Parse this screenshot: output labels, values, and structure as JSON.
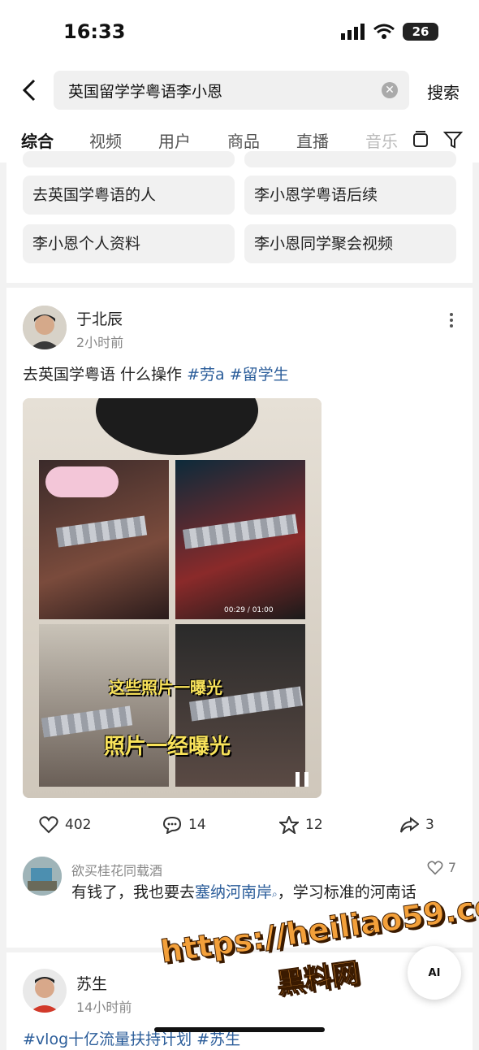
{
  "status": {
    "time": "16:33",
    "battery": "26"
  },
  "search": {
    "query": "英国留学学粤语李小恩",
    "button": "搜索"
  },
  "tabs": [
    "综合",
    "视频",
    "用户",
    "商品",
    "直播",
    "音乐"
  ],
  "suggestions": [
    "去英国学粤语的人",
    "李小恩学粤语后续",
    "李小恩个人资料",
    "李小恩同学聚会视频"
  ],
  "post": {
    "author": "于北辰",
    "time": "2小时前",
    "text": "去英国学粤语 什么操作 ",
    "tags": [
      "#劳a",
      "#留学生"
    ],
    "overlay_top": "这些照片一曝光",
    "overlay_bottom": "照片一经曝光",
    "video_time": "00:29 / 01:00",
    "likes": "402",
    "comments": "14",
    "favorites": "12",
    "shares": "3"
  },
  "comment": {
    "author": "欲买桂花同载酒",
    "likes": "7",
    "text_before": "有钱了，我也要去",
    "link": "塞纳河南岸",
    "text_after": "，学习标准的河南话"
  },
  "post2": {
    "author": "苏生",
    "time": "14小时前",
    "text": "#vlog十亿流量扶持计划 #苏生"
  },
  "ai_button": "AI",
  "watermark": {
    "url": "https://heiliao59.com",
    "name": "黑料网"
  }
}
